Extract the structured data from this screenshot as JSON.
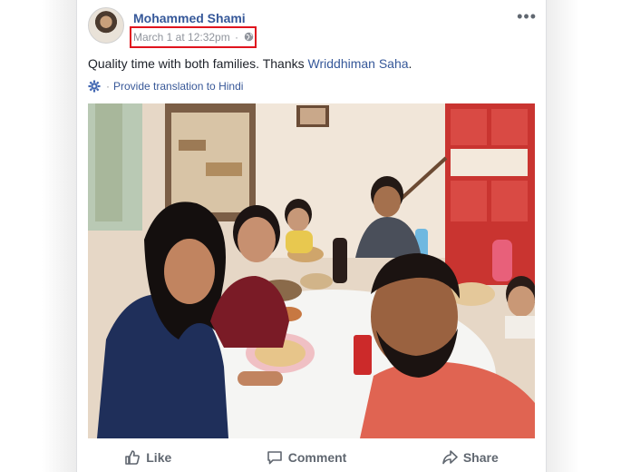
{
  "post": {
    "author": "Mohammed Shami",
    "timestamp": "March 1 at 12:32pm",
    "separator": "·",
    "text_prefix": "Quality time with both families. Thanks ",
    "mention": "Wriddhiman Saha",
    "text_suffix": ".",
    "translate_link": "Provide translation to Hindi",
    "more_menu": "•••"
  },
  "actions": {
    "like": "Like",
    "comment": "Comment",
    "share": "Share"
  },
  "colors": {
    "link": "#365899",
    "meta": "#90949c",
    "highlight": "#e0141e"
  }
}
